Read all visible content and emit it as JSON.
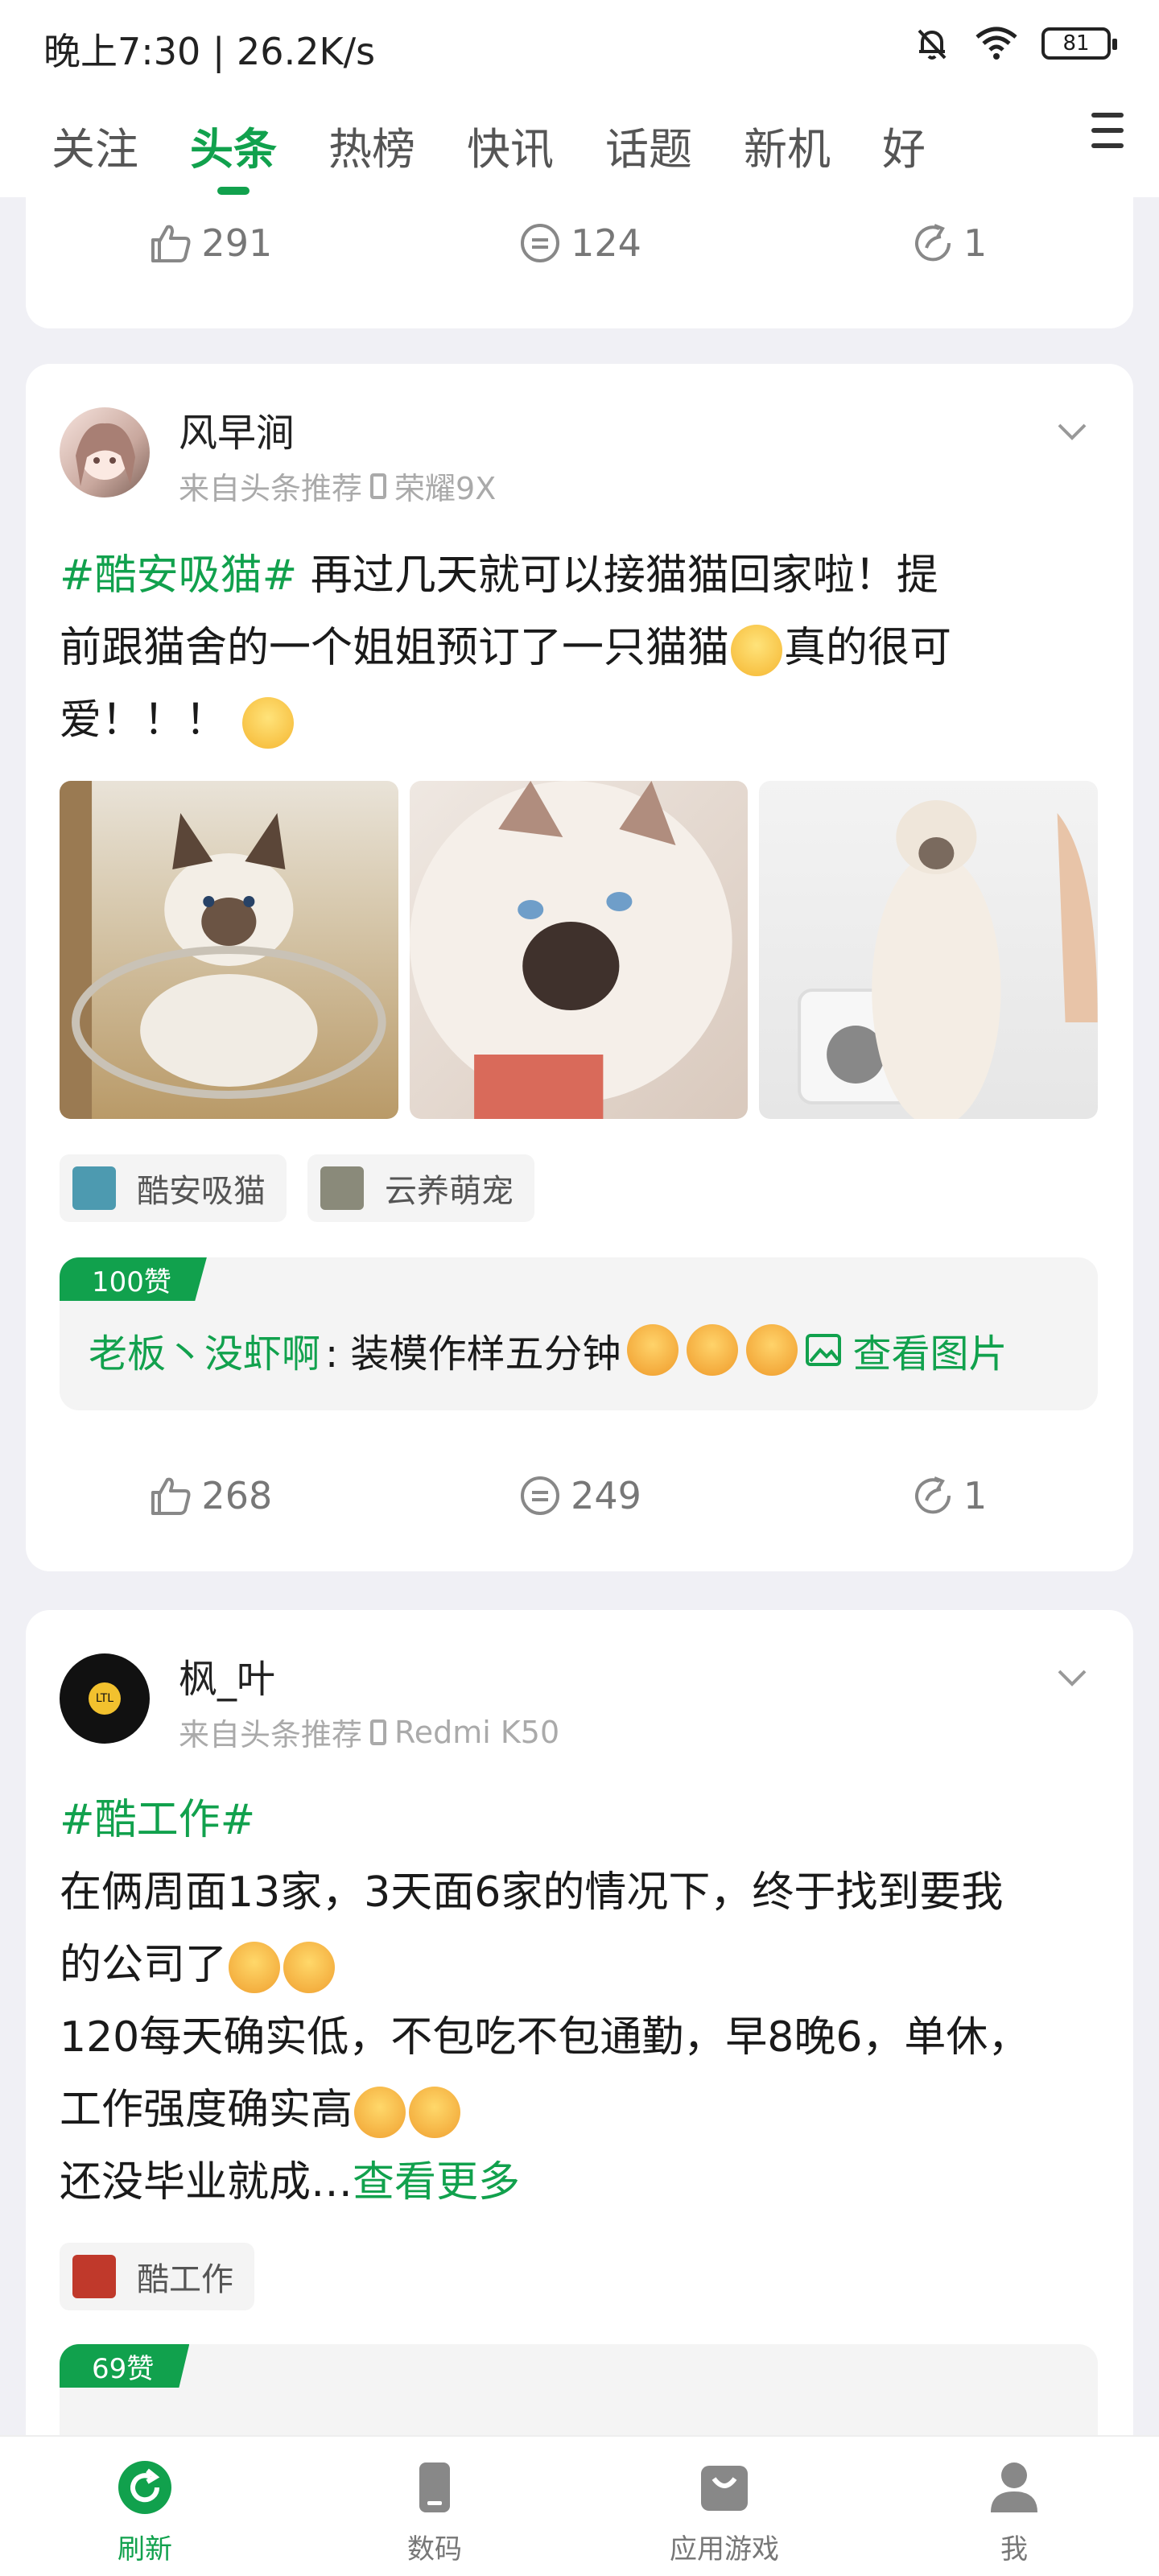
{
  "status_bar": {
    "time": "晚上7:30 | 26.2K/s",
    "battery": "81"
  },
  "tabs": [
    "关注",
    "头条",
    "热榜",
    "快讯",
    "话题",
    "新机",
    "好"
  ],
  "active_tab": "头条",
  "card0": {
    "likes": "291",
    "comments": "124",
    "shares": "1"
  },
  "post1": {
    "username": "风早涧",
    "source": "来自头条推荐",
    "device": "荣耀9X",
    "topic": "#酷安吸猫#",
    "line1": "再过几天就可以接猫猫回家啦！提",
    "line2a": "前跟猫舍的一个姐姐预订了一只猫猫",
    "line2b": "真的很可",
    "line3": "爱！！！",
    "tags": [
      "酷安吸猫",
      "云养萌宠"
    ],
    "hot_badge": "100赞",
    "hot_user": "老板丶没虾啊",
    "hot_text": ": 装模作样五分钟",
    "hot_view": "查看图片",
    "likes": "268",
    "comments": "249",
    "shares": "1"
  },
  "post2": {
    "username": "枫_叶",
    "avatar_text": "LTL",
    "source": "来自头条推荐",
    "device": "Redmi K50",
    "topic": "#酷工作#",
    "line1": "在俩周面13家，3天面6家的情况下，终于找到要我",
    "line2": "的公司了",
    "line3": "120每天确实低，不包吃不包通勤，早8晚6，单休，",
    "line4": "工作强度确实高",
    "line5": "还没毕业就成…",
    "more": "查看更多",
    "tag": "酷工作",
    "hot_badge": "69赞"
  },
  "bottom_nav": [
    "刷新",
    "数码",
    "应用游戏",
    "我"
  ],
  "colors": {
    "accent": "#11a14d",
    "background": "#f0f0f5"
  }
}
